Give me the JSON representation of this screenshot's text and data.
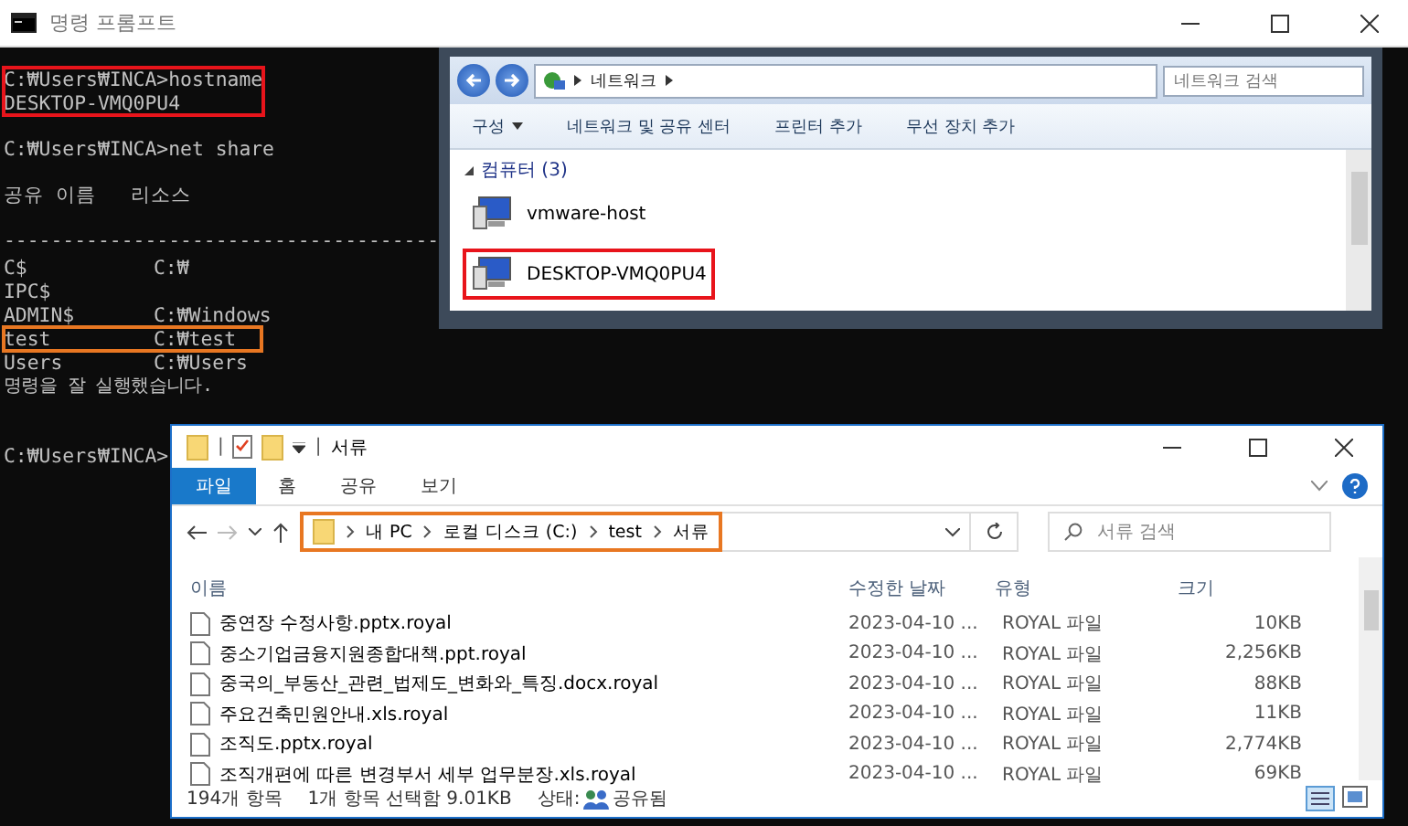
{
  "console": {
    "title": "명령 프롬프트",
    "blocks": [
      {
        "lines": [
          "C:₩Users₩INCA>hostname",
          "DESKTOP-VMQ0PU4"
        ],
        "highlighted": true,
        "color": "#e8141b"
      },
      {
        "lines": [
          "C:₩Users₩INCA>net share"
        ],
        "highlighted": false
      },
      {
        "lines": [
          "공유 이름   리소스"
        ],
        "highlighted": false
      },
      {
        "lines": [
          "-------------------------------------"
        ],
        "highlighted": false
      }
    ],
    "shares": [
      {
        "name": "C$",
        "resource": "C:₩",
        "highlighted": false
      },
      {
        "name": "IPC$",
        "highlighted": false
      },
      {
        "name": "ADMIN$",
        "resource": "C:₩Windows",
        "highlighted": false
      },
      {
        "name": "test",
        "resource": "C:₩test",
        "highlighted": true,
        "color": "#e87722"
      },
      {
        "name": "Users",
        "resource": "C:₩Users",
        "highlighted": false
      }
    ],
    "result": "명령을 잘 실행했습니다.",
    "prompt": "C:₩Users₩INCA>"
  },
  "network_window": {
    "breadcrumb": [
      "네트워크"
    ],
    "search": {
      "placeholder": "네트워크 검색"
    },
    "toolbar": [
      {
        "label": "구성",
        "menu": true
      },
      {
        "label": "네트워크 및 공유 센터",
        "menu": false
      },
      {
        "label": "프린터 추가",
        "menu": false
      },
      {
        "label": "무선 장치 추가",
        "menu": false
      }
    ],
    "group": {
      "label": "컴퓨터 (3)",
      "expanded": true
    },
    "computers": [
      {
        "name": "vmware-host",
        "highlighted": false
      },
      {
        "name": "DESKTOP-VMQ0PU4",
        "highlighted": true,
        "color": "#e8141b"
      }
    ]
  },
  "explorer": {
    "quick_access": [
      "|",
      "|"
    ],
    "title": "서류",
    "tabs": [
      {
        "label": "파일",
        "selected": true
      },
      {
        "label": "홈",
        "selected": false
      },
      {
        "label": "공유",
        "selected": false
      },
      {
        "label": "보기",
        "selected": false
      }
    ],
    "address": {
      "parts": [
        "내 PC",
        "로컬 디스크 (C:)",
        "test",
        "서류"
      ],
      "highlighted": true,
      "color": "#e87722"
    },
    "search": {
      "placeholder": "서류 검색"
    },
    "columns": [
      "이름",
      "수정한 날짜",
      "유형",
      "크기"
    ],
    "rows": [
      {
        "name": "중연장 수정사항.pptx.royal",
        "modified": "2023-04-10 ...",
        "type": "ROYAL 파일",
        "size": "10KB"
      },
      {
        "name": "중소기업금융지원종합대책.ppt.royal",
        "modified": "2023-04-10 ...",
        "type": "ROYAL 파일",
        "size": "2,256KB"
      },
      {
        "name": "중국의_부동산_관련_법제도_변화와_특징.docx.royal",
        "modified": "2023-04-10 ...",
        "type": "ROYAL 파일",
        "size": "88KB"
      },
      {
        "name": "주요건축민원안내.xls.royal",
        "modified": "2023-04-10 ...",
        "type": "ROYAL 파일",
        "size": "11KB"
      },
      {
        "name": "조직도.pptx.royal",
        "modified": "2023-04-10 ...",
        "type": "ROYAL 파일",
        "size": "2,774KB"
      },
      {
        "name": "조직개편에 따른 변경부서 세부 업무분장.xls.royal",
        "modified": "2023-04-10 ...",
        "type": "ROYAL 파일",
        "size": "69KB"
      }
    ],
    "status": {
      "count": "194개 항목",
      "selection": "1개 항목 선택함 9.01KB",
      "state_label": "상태:",
      "state": "공유됨"
    }
  }
}
